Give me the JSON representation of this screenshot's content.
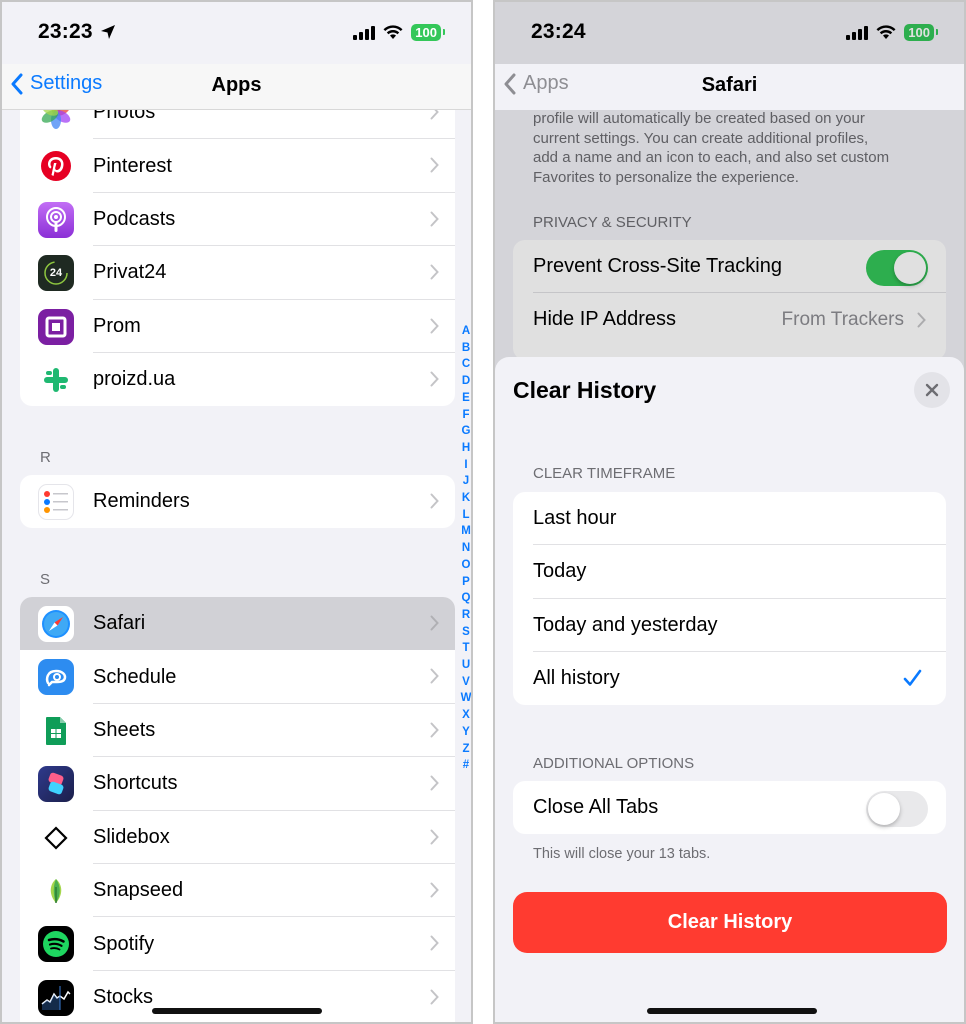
{
  "left": {
    "status": {
      "time": "23:23",
      "battery": "100"
    },
    "nav": {
      "back": "Settings",
      "title": "Apps"
    },
    "groups": {
      "p": [
        {
          "label": "Photos",
          "icon": "photos-icon"
        },
        {
          "label": "Pinterest",
          "icon": "pinterest-icon"
        },
        {
          "label": "Podcasts",
          "icon": "podcasts-icon"
        },
        {
          "label": "Privat24",
          "icon": "privat24-icon",
          "icon_text": "24"
        },
        {
          "label": "Prom",
          "icon": "prom-icon"
        },
        {
          "label": "proizd.ua",
          "icon": "proizd-icon"
        }
      ],
      "r_header": "R",
      "r": [
        {
          "label": "Reminders",
          "icon": "reminders-icon"
        }
      ],
      "s_header": "S",
      "s": [
        {
          "label": "Safari",
          "icon": "safari-icon",
          "selected": true
        },
        {
          "label": "Schedule",
          "icon": "schedule-icon"
        },
        {
          "label": "Sheets",
          "icon": "sheets-icon"
        },
        {
          "label": "Shortcuts",
          "icon": "shortcuts-icon"
        },
        {
          "label": "Slidebox",
          "icon": "slidebox-icon"
        },
        {
          "label": "Snapseed",
          "icon": "snapseed-icon"
        },
        {
          "label": "Spotify",
          "icon": "spotify-icon"
        },
        {
          "label": "Stocks",
          "icon": "stocks-icon"
        }
      ]
    },
    "index": [
      "A",
      "B",
      "C",
      "D",
      "E",
      "F",
      "G",
      "H",
      "I",
      "J",
      "K",
      "L",
      "M",
      "N",
      "O",
      "P",
      "Q",
      "R",
      "S",
      "T",
      "U",
      "V",
      "W",
      "X",
      "Y",
      "Z",
      "#"
    ]
  },
  "right": {
    "status": {
      "time": "23:24",
      "battery": "100"
    },
    "nav": {
      "back": "Apps",
      "title": "Safari"
    },
    "profile_text": [
      "profile will automatically be created based on your",
      "current settings. You can create additional profiles,",
      "add a name and an icon to each, and also set custom",
      "Favorites to personalize the experience."
    ],
    "privacy_header": "PRIVACY & SECURITY",
    "tracking_label": "Prevent Cross-Site Tracking",
    "tracking_on": true,
    "hide_ip_label": "Hide IP Address",
    "hide_ip_value": "From Trackers",
    "sheet": {
      "title": "Clear History",
      "timeframe_header": "CLEAR TIMEFRAME",
      "timeframes": [
        {
          "label": "Last hour",
          "checked": false
        },
        {
          "label": "Today",
          "checked": false
        },
        {
          "label": "Today and yesterday",
          "checked": false
        },
        {
          "label": "All history",
          "checked": true
        }
      ],
      "options_header": "ADDITIONAL OPTIONS",
      "close_tabs_label": "Close All Tabs",
      "close_tabs_on": false,
      "close_tabs_note": "This will close your 13 tabs.",
      "clear_button": "Clear History"
    }
  },
  "colors": {
    "accent": "#0a7aff",
    "green": "#34c759",
    "red": "#ff3b30"
  }
}
